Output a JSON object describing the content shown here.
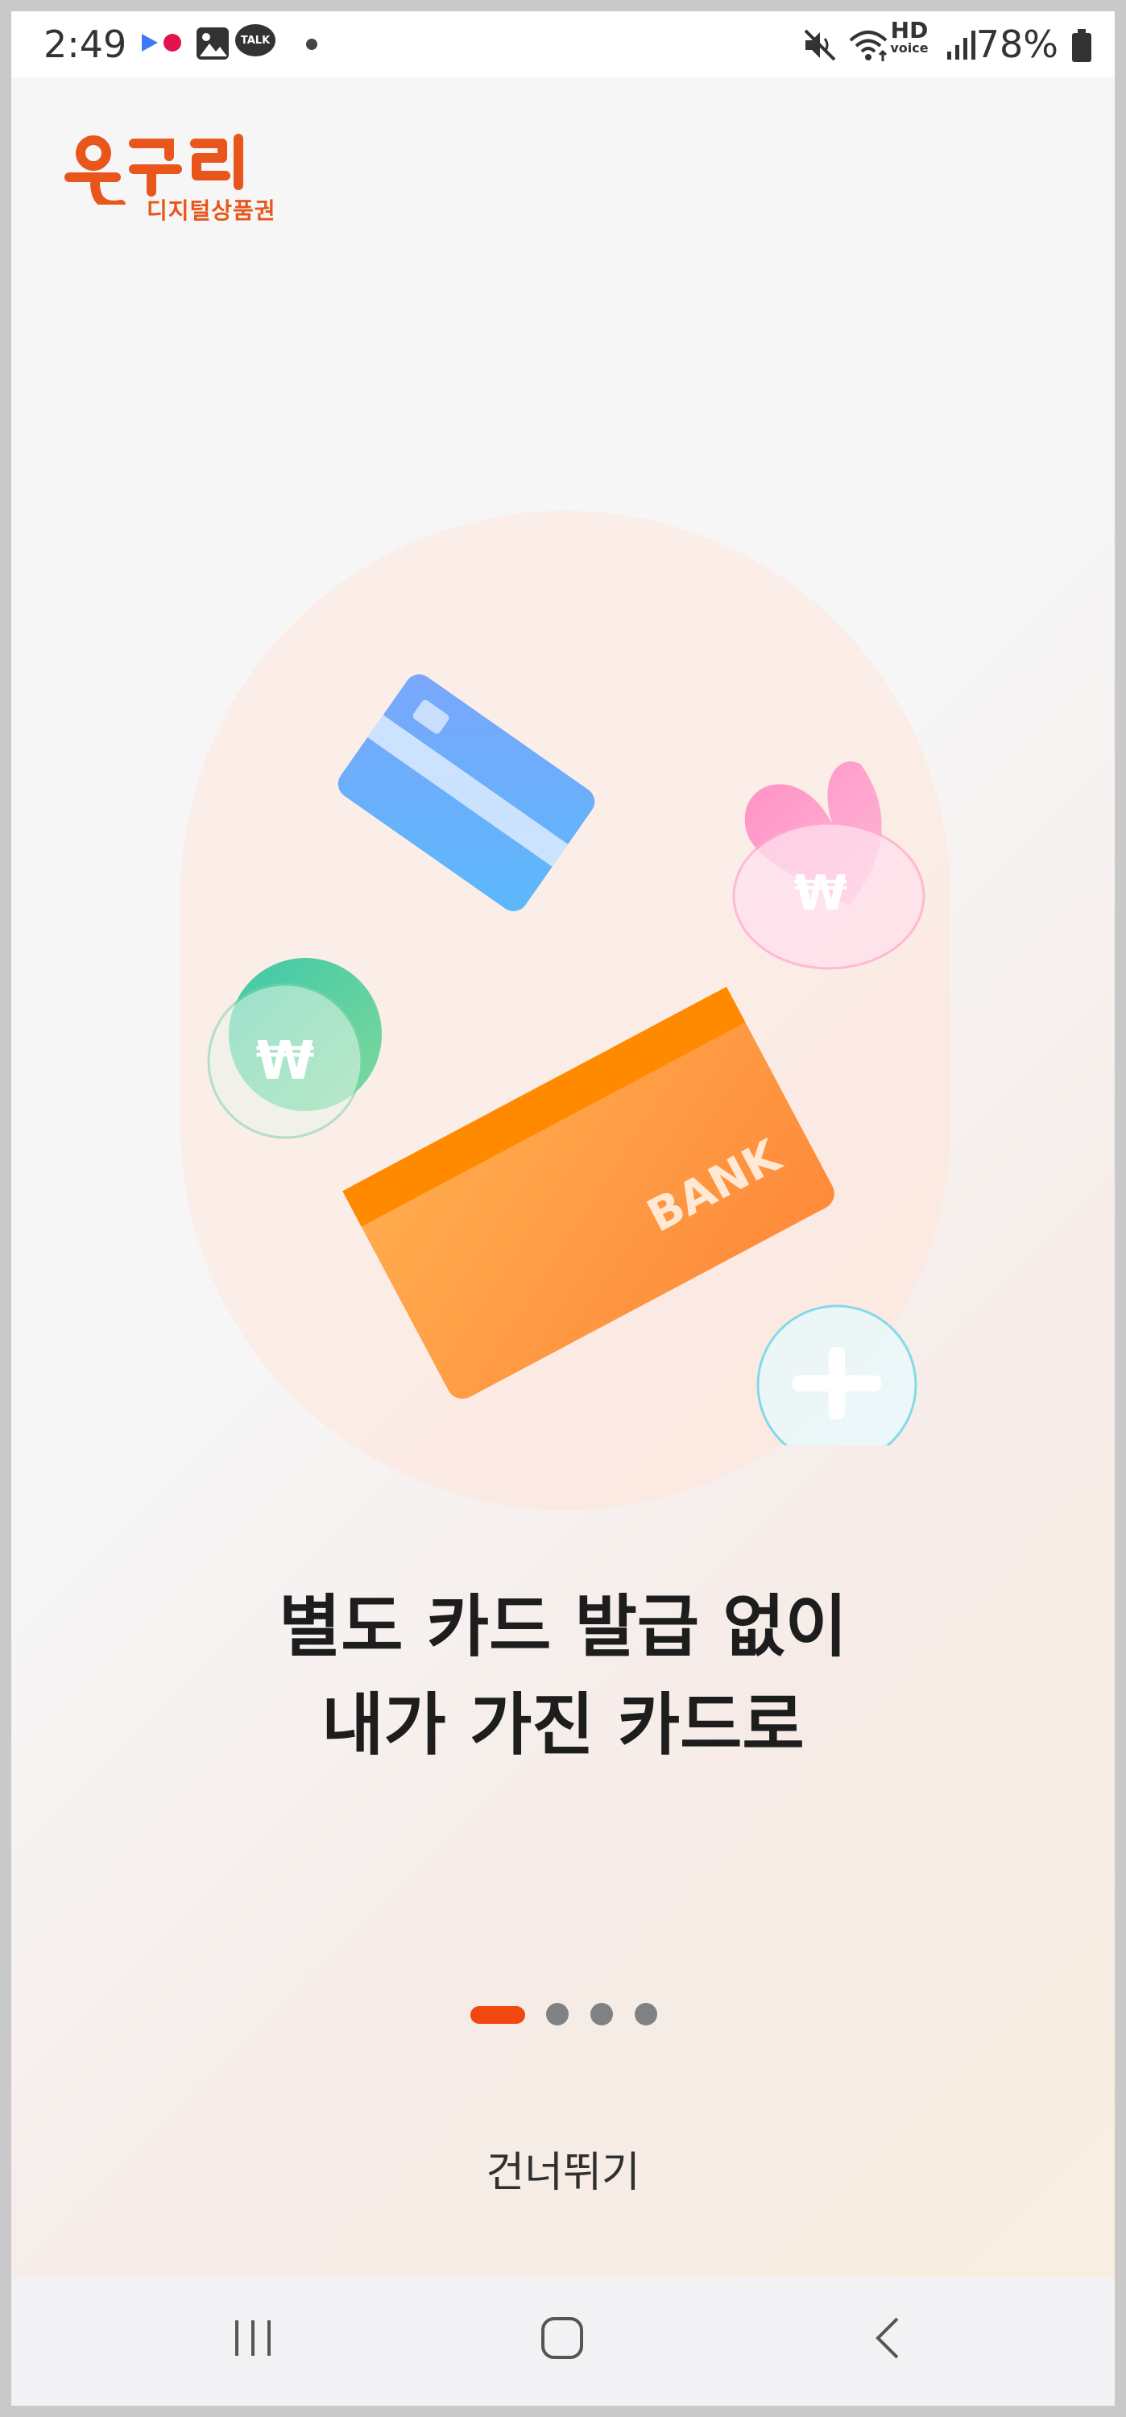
{
  "status_bar": {
    "time": "2:49",
    "talk_label": "TALK",
    "hd_label": "HD",
    "voice_label": "voice",
    "battery_percent": "78%"
  },
  "logo": {
    "subtitle": "디지털상품권",
    "brand_color": "#e8561c"
  },
  "illustration": {
    "bank_label": "BANK",
    "won_symbol": "₩"
  },
  "headline": {
    "line1": "별도 카드 발급 없이",
    "line2": "내가 가진 카드로"
  },
  "pager": {
    "total": 4,
    "current": 1,
    "active_color": "#f0480e",
    "inactive_color": "#7f8183"
  },
  "skip_label": "건너뛰기",
  "nav_bar": {
    "icons": [
      "recent-apps-icon",
      "home-icon",
      "back-icon"
    ]
  }
}
